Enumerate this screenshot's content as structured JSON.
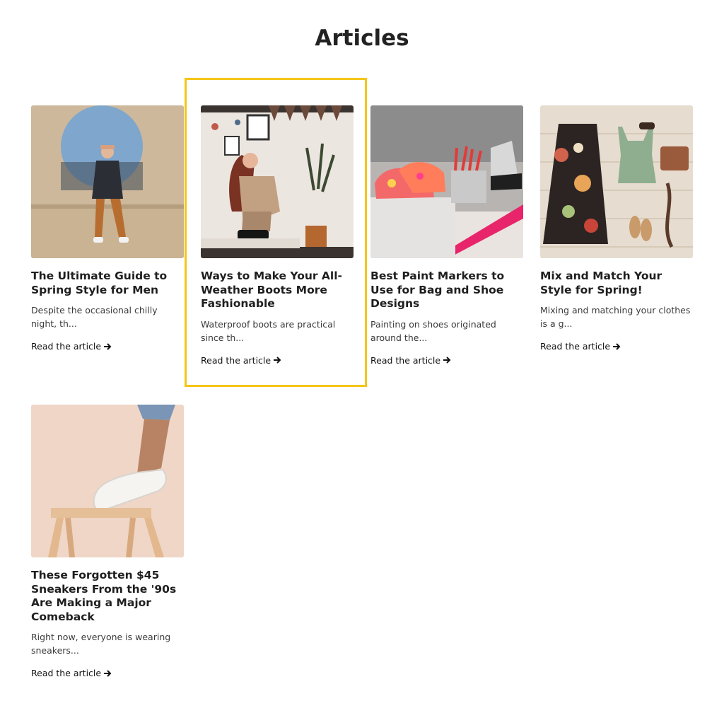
{
  "page": {
    "title": "Articles"
  },
  "articles": [
    {
      "title": "The Ultimate Guide to Spring Style for Men",
      "excerpt": "Despite the occasional chilly night, th...",
      "link_label": "Read the article",
      "image": "man-sitting-on-wall-photo"
    },
    {
      "title": "Ways to Make Your All-Weather Boots More Fashionable",
      "excerpt": "Waterproof boots are practical since th...",
      "link_label": "Read the article",
      "image": "woman-crouching-in-boots-photo"
    },
    {
      "title": "Best Paint Markers to Use for Bag and Shoe Designs",
      "excerpt": "Painting on shoes originated around the...",
      "link_label": "Read the article",
      "image": "painted-sneakers-photo"
    },
    {
      "title": "Mix and Match Your Style for Spring!",
      "excerpt": "Mixing and matching your clothes is a g...",
      "link_label": "Read the article",
      "image": "outfit-flatlay-photo"
    },
    {
      "title": "These Forgotten $45 Sneakers From the '90s Are Making a Major Comeback",
      "excerpt": "Right now, everyone is wearing sneakers...",
      "link_label": "Read the article",
      "image": "slip-on-sneaker-on-stool-photo"
    }
  ],
  "colors": {
    "highlight": "#f5c518",
    "text": "#222222"
  },
  "icons": {
    "read_more": "arrow-right-icon"
  }
}
